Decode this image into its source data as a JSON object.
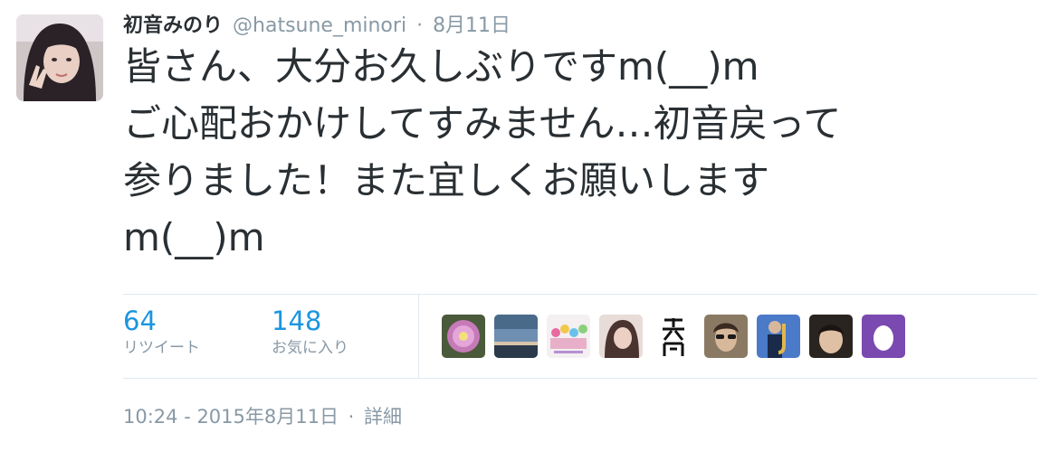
{
  "tweet": {
    "display_name": "初音みのり",
    "handle": "@hatsune_minori",
    "separator": "·",
    "date": "8月11日",
    "text_lines": [
      "皆さん、大分お久しぶりですm(__)m",
      "ご心配おかけしてすみません…初音戻って",
      "参りました！また宜しくお願いします",
      "m(__)m"
    ]
  },
  "stats": {
    "retweets": {
      "count": "64",
      "label": "リツイート"
    },
    "likes": {
      "count": "148",
      "label": "お気に入り"
    }
  },
  "likers": [
    {
      "icon": "cactus-flower-icon",
      "color": "#b06aa8"
    },
    {
      "icon": "sky-sunset-icon",
      "color": "#4a6a8a"
    },
    {
      "icon": "colorful-group-icon",
      "color": "#e8b0c8"
    },
    {
      "icon": "girl-portrait-icon",
      "color": "#c9a89a"
    },
    {
      "icon": "kanji-calligraphy-icon",
      "color": "#111111"
    },
    {
      "icon": "man-sunglasses-icon",
      "color": "#7a6a58"
    },
    {
      "icon": "saxophone-player-icon",
      "color": "#2a5aa8"
    },
    {
      "icon": "man-portrait-icon",
      "color": "#3a3028"
    },
    {
      "icon": "default-egg-icon",
      "color": "#7a4ab0"
    }
  ],
  "footer": {
    "time": "10:24 - 2015年8月11日",
    "separator": "·",
    "details": "詳細"
  },
  "colors": {
    "link_blue": "#1b95e0",
    "muted": "#8899a6",
    "text": "#292f33",
    "border": "#e1e8ed"
  }
}
